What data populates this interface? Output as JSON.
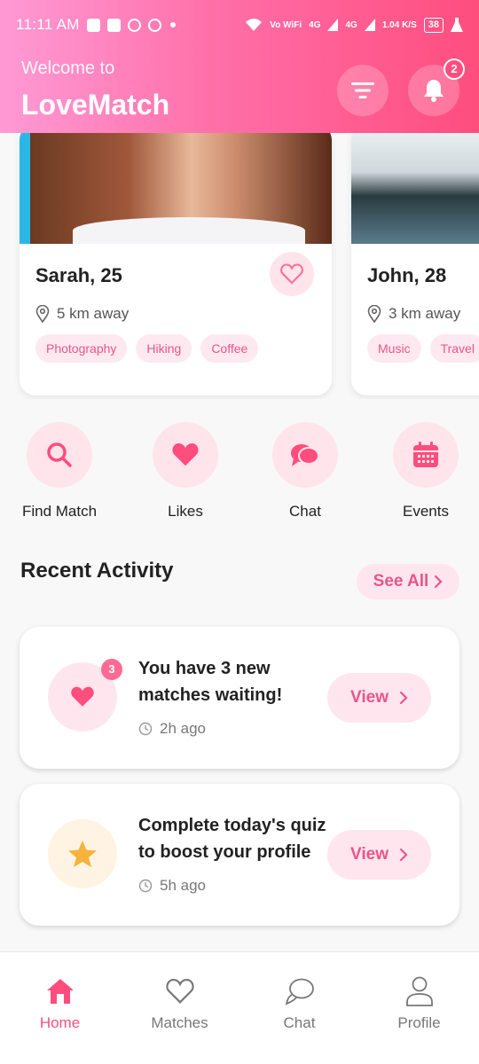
{
  "status_bar": {
    "time": "11:11 AM",
    "network": "Vo WiFi",
    "signal1": "4G",
    "signal2": "4G",
    "speed": "1.04 K/S",
    "battery": "38"
  },
  "header": {
    "welcome": "Welcome to",
    "title": "LoveMatch",
    "notification_count": "2",
    "gradient": [
      "#ff9ad5",
      "#ff4d7e"
    ]
  },
  "profiles": [
    {
      "name": "Sarah, 25",
      "distance": "5 km away",
      "tags": [
        "Photography",
        "Hiking",
        "Coffee"
      ]
    },
    {
      "name": "John, 28",
      "distance": "3 km away",
      "tags": [
        "Music",
        "Travel"
      ]
    }
  ],
  "quick_actions": [
    {
      "label": "Find Match",
      "icon": "search-icon"
    },
    {
      "label": "Likes",
      "icon": "heart-icon"
    },
    {
      "label": "Chat",
      "icon": "chat-icon"
    },
    {
      "label": "Events",
      "icon": "calendar-icon"
    }
  ],
  "recent_activity": {
    "title": "Recent Activity",
    "see_all": "See All",
    "items": [
      {
        "title": "You have 3 new matches waiting!",
        "time": "2h ago",
        "badge": "3",
        "button": "View",
        "icon": "heart-icon"
      },
      {
        "title": "Complete today's quiz to boost your profile",
        "time": "5h ago",
        "button": "View",
        "icon": "star-icon"
      }
    ]
  },
  "bottom_nav": [
    {
      "label": "Home",
      "icon": "home-icon",
      "active": true
    },
    {
      "label": "Matches",
      "icon": "heart-outline-icon",
      "active": false
    },
    {
      "label": "Chat",
      "icon": "chat-outline-icon",
      "active": false
    },
    {
      "label": "Profile",
      "icon": "person-icon",
      "active": false
    }
  ],
  "colors": {
    "accent": "#ff4d7e",
    "accent_soft": "#ffe6ee",
    "tag_text": "#e8558a",
    "star": "#f6b33d"
  }
}
